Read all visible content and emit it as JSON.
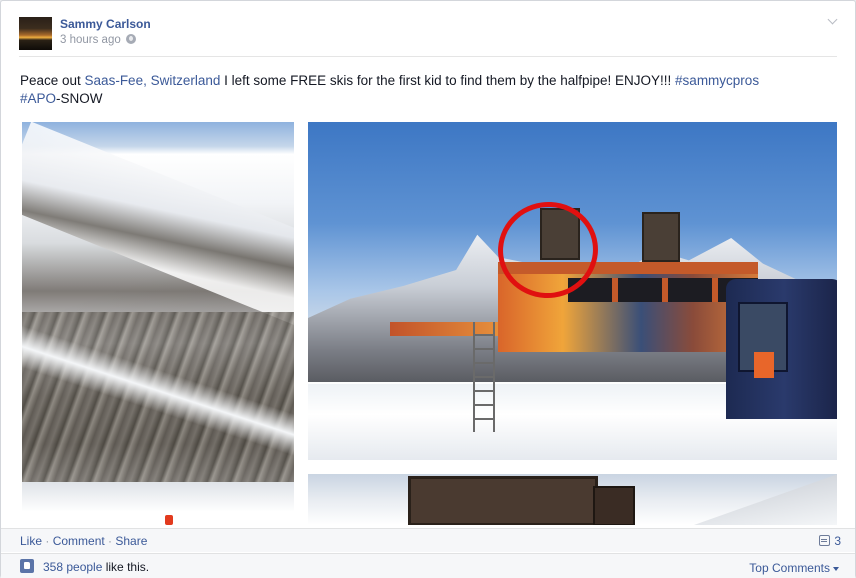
{
  "post": {
    "author": "Sammy Carlson",
    "timestamp": "3 hours ago",
    "privacy_icon": "globe-icon",
    "text": {
      "t1": "Peace out ",
      "place": "Saas-Fee, Switzerland",
      "t2": " I left some FREE skis for the first kid to find them by the halfpipe! ENJOY!!! ",
      "hashtag1": "#sammycpros",
      "hashtag2": "#APO",
      "t3": "-SNOW"
    }
  },
  "actions": {
    "like": "Like",
    "sep1": " · ",
    "comment": "Comment",
    "sep2": " · ",
    "share": "Share",
    "comment_count": "3"
  },
  "likes": {
    "count_link": "358 people",
    "suffix": " like this.",
    "top_comments": "Top Comments"
  },
  "colors": {
    "link": "#3b5998",
    "muted": "#9197a3",
    "circle": "#e01010"
  }
}
